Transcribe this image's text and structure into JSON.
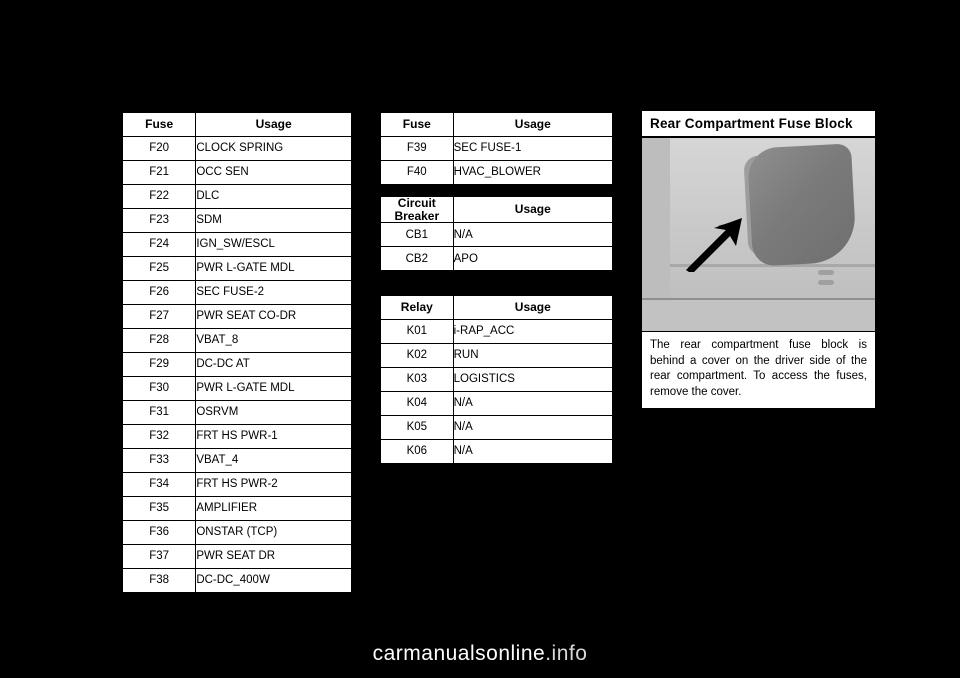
{
  "fuse_table_left": {
    "headers": [
      "Fuse",
      "Usage"
    ],
    "rows": [
      [
        "F20",
        "CLOCK SPRING"
      ],
      [
        "F21",
        "OCC SEN"
      ],
      [
        "F22",
        "DLC"
      ],
      [
        "F23",
        "SDM"
      ],
      [
        "F24",
        "IGN_SW/ESCL"
      ],
      [
        "F25",
        "PWR L-GATE MDL"
      ],
      [
        "F26",
        "SEC FUSE-2"
      ],
      [
        "F27",
        "PWR SEAT CO-DR"
      ],
      [
        "F28",
        "VBAT_8"
      ],
      [
        "F29",
        "DC-DC AT"
      ],
      [
        "F30",
        "PWR L-GATE MDL"
      ],
      [
        "F31",
        "OSRVM"
      ],
      [
        "F32",
        "FRT HS PWR-1"
      ],
      [
        "F33",
        "VBAT_4"
      ],
      [
        "F34",
        "FRT HS PWR-2"
      ],
      [
        "F35",
        "AMPLIFIER"
      ],
      [
        "F36",
        "ONSTAR (TCP)"
      ],
      [
        "F37",
        "PWR SEAT DR"
      ],
      [
        "F38",
        "DC-DC_400W"
      ]
    ]
  },
  "fuse_table_right": {
    "headers": [
      "Fuse",
      "Usage"
    ],
    "rows": [
      [
        "F39",
        "SEC FUSE-1"
      ],
      [
        "F40",
        "HVAC_BLOWER"
      ]
    ]
  },
  "circuit_breaker_table": {
    "headers": [
      "Circuit Breaker",
      "Usage"
    ],
    "header_line1": "Circuit",
    "header_line2": "Breaker",
    "rows": [
      [
        "CB1",
        "N/A"
      ],
      [
        "CB2",
        "APO"
      ]
    ]
  },
  "relay_table": {
    "headers": [
      "Relay",
      "Usage"
    ],
    "rows": [
      [
        "K01",
        "i-RAP_ACC"
      ],
      [
        "K02",
        "RUN"
      ],
      [
        "K03",
        "LOGISTICS"
      ],
      [
        "K04",
        "N/A"
      ],
      [
        "K05",
        "N/A"
      ],
      [
        "K06",
        "N/A"
      ]
    ]
  },
  "rear_panel": {
    "title": "Rear Compartment Fuse Block",
    "caption": "The rear compartment fuse block is behind a cover on the driver side of the rear compartment. To access the fuses, remove the cover."
  },
  "footer": {
    "url_main": "carmanualsonline",
    "url_suffix": ".info"
  }
}
